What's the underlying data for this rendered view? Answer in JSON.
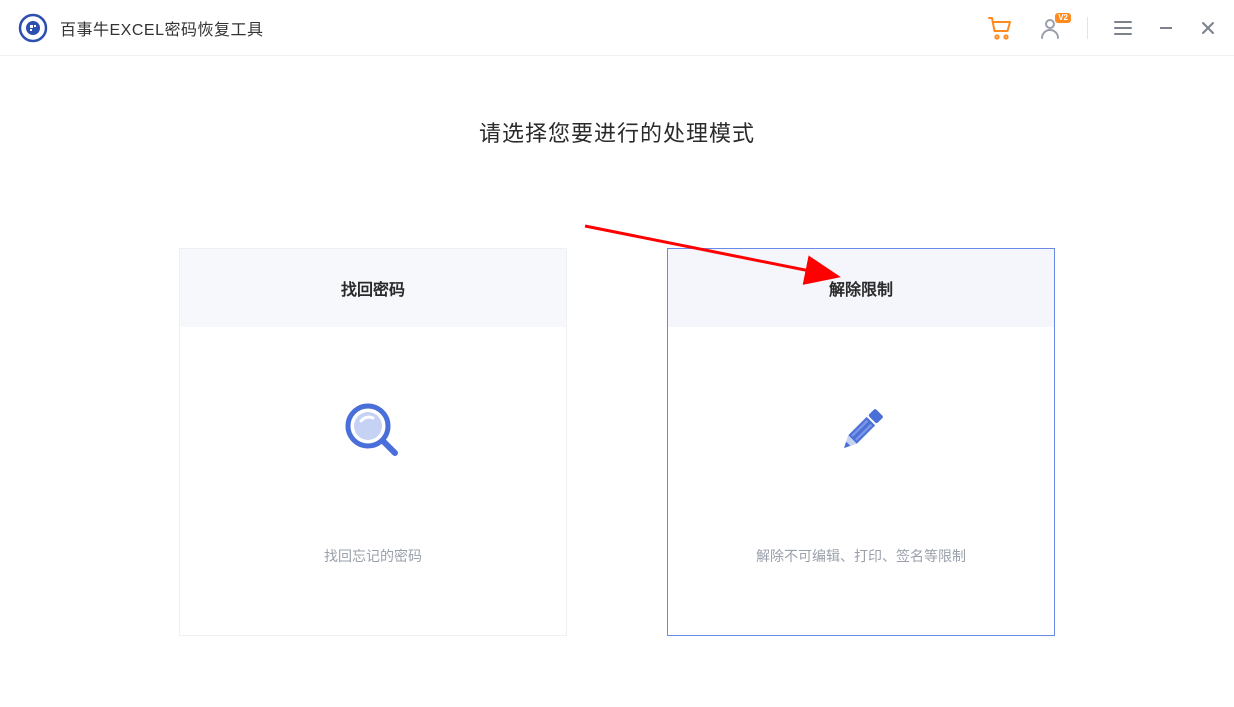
{
  "app": {
    "title": "百事牛EXCEL密码恢复工具"
  },
  "titlebar": {
    "user_badge": "V2"
  },
  "main": {
    "heading": "请选择您要进行的处理模式"
  },
  "cards": {
    "recover": {
      "title": "找回密码",
      "desc": "找回忘记的密码"
    },
    "remove": {
      "title": "解除限制",
      "desc": "解除不可编辑、打印、签名等限制"
    }
  }
}
